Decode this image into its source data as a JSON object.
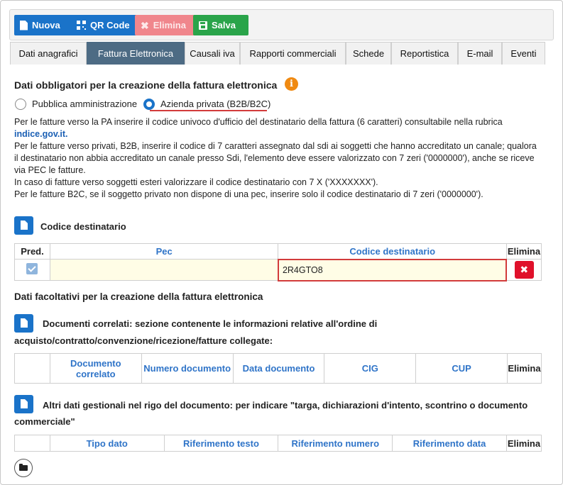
{
  "toolbar": {
    "nuova": "Nuova",
    "qr": "QR Code",
    "elimina": "Elimina",
    "salva": "Salva"
  },
  "tabs": [
    {
      "label": "Dati anagrafici"
    },
    {
      "label": "Fattura Elettronica"
    },
    {
      "label": "Causali iva"
    },
    {
      "label": "Rapporti commerciali"
    },
    {
      "label": "Schede"
    },
    {
      "label": "Reportistica"
    },
    {
      "label": "E-mail"
    },
    {
      "label": "Eventi"
    }
  ],
  "section1": {
    "title": "Dati obbligatori per la creazione della fattura elettronica",
    "radio_pa": "Pubblica amministrazione",
    "radio_privata": "Azienda privata (B2B/B2C)",
    "lines": [
      "Per le fatture verso la PA inserire il codice univoco d'ufficio del destinatario della fattura (6 caratteri) consultabile nella rubrica",
      "indice.gov.it.",
      "Per le fatture verso privati, B2B, inserire il codice di 7 caratteri assegnato dal sdi ai soggetti che hanno accreditato un canale; qualora",
      "il destinatario non abbia accreditato un canale presso Sdi, l'elemento deve essere valorizzato con 7 zeri ('0000000'), anche se riceve",
      "via PEC le fatture.",
      "In caso di fatture verso soggetti esteri valorizzare il codice destinatario con 7 X ('XXXXXXX').",
      "Per le fatture B2C, se il soggetto privato non dispone di una pec, inserire solo il codice destinatario di 7 zeri ('0000000')."
    ]
  },
  "codice": {
    "title": "Codice destinatario",
    "headers": [
      "Pred.",
      "Pec",
      "Codice destinatario",
      "Elimina"
    ],
    "row": {
      "pec": "",
      "codice": "2R4GTO8",
      "delete": "✖"
    }
  },
  "section2": {
    "title": "Dati facoltativi per la creazione della fattura elettronica"
  },
  "documenti": {
    "title_line1": "Documenti correlati: sezione contenente le informazioni relative all'ordine di",
    "title_line2": "acquisto/contratto/convenzione/ricezione/fatture collegate:",
    "headers": [
      "",
      "Documento correlato",
      "Numero documento",
      "Data documento",
      "CIG",
      "CUP",
      "Elimina"
    ]
  },
  "altri": {
    "title_line1": "Altri dati gestionali nel rigo del documento: per indicare \"targa, dichiarazioni d'intento, scontrino o documento",
    "title_line2": "commerciale\"",
    "headers": [
      "",
      "Tipo dato",
      "Riferimento testo",
      "Riferimento numero",
      "Riferimento data",
      "Elimina"
    ]
  },
  "icons": {
    "nuova": "file-icon",
    "qr": "qr-code-icon",
    "elimina": "times-icon",
    "salva": "save-icon",
    "info": "info-icon",
    "folder": "folder-icon"
  }
}
